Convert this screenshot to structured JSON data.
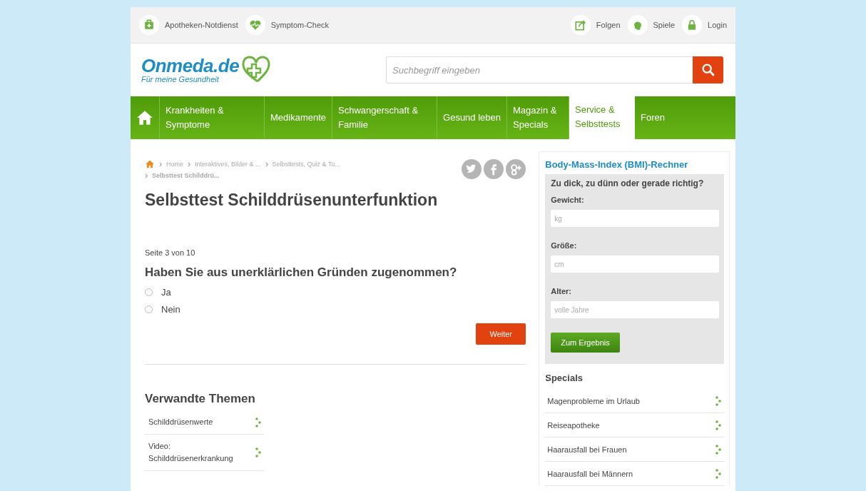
{
  "top_bar": {
    "left": [
      {
        "label": "Apotheken-Notdienst",
        "kind": "kit"
      },
      {
        "label": "Symptom-Check",
        "kind": "heart"
      }
    ],
    "right": [
      {
        "label": "Folgen",
        "kind": "share"
      },
      {
        "label": "Spiele",
        "kind": "head"
      },
      {
        "label": "Login",
        "kind": "lock"
      }
    ]
  },
  "logo": {
    "name": "Onmeda.de",
    "tagline": "Für meine Gesundheit"
  },
  "search": {
    "placeholder": "Suchbegriff eingeben"
  },
  "nav": [
    {
      "label": "Krankheiten & Symptome",
      "selected": false
    },
    {
      "label": "Medikamente",
      "selected": false
    },
    {
      "label": "Schwangerschaft & Familie",
      "selected": false
    },
    {
      "label": "Gesund leben",
      "selected": false
    },
    {
      "label": "Magazin & Specials",
      "selected": false
    },
    {
      "label": "Service & Selbsttests",
      "selected": true
    },
    {
      "label": "Foren",
      "selected": false
    }
  ],
  "breadcrumb": [
    "Home",
    "Interaktives, Bilder & ...",
    "Selbsttests, Quiz & To...",
    "Selbsttest Schilddrü..."
  ],
  "share": [
    {
      "kind": "twitter"
    },
    {
      "kind": "facebook"
    },
    {
      "kind": "googleplus"
    }
  ],
  "title": "Selbsttest Schilddrüsenunterfunktion",
  "page_info": "Seite 3 von 10",
  "question": "Haben Sie aus unerklärlichen Gründen zugenommen?",
  "options": [
    {
      "label": "Ja",
      "selected": false
    },
    {
      "label": "Nein",
      "selected": false
    }
  ],
  "next_button": "Weiter",
  "related": {
    "heading": "Verwandte Themen",
    "items": [
      "Schilddrüsenwerte",
      "Video: Schilddrüsenerkrankung"
    ]
  },
  "bmi": {
    "heading": "Body-Mass-Index (BMI)-Rechner",
    "subheading": "Zu dick, zu dünn oder gerade richtig?",
    "fields": [
      {
        "label": "Gewicht:",
        "placeholder": "kg"
      },
      {
        "label": "Größe:",
        "placeholder": "cm"
      },
      {
        "label": "Alter:",
        "placeholder": "volle Jahre"
      }
    ],
    "button": "Zum Ergebnis"
  },
  "specials": {
    "heading": "Specials",
    "items": [
      "Magenprobleme im Urlaub",
      "Reiseapotheke",
      "Haarausfall bei Frauen",
      "Haarausfall bei Männern"
    ]
  }
}
